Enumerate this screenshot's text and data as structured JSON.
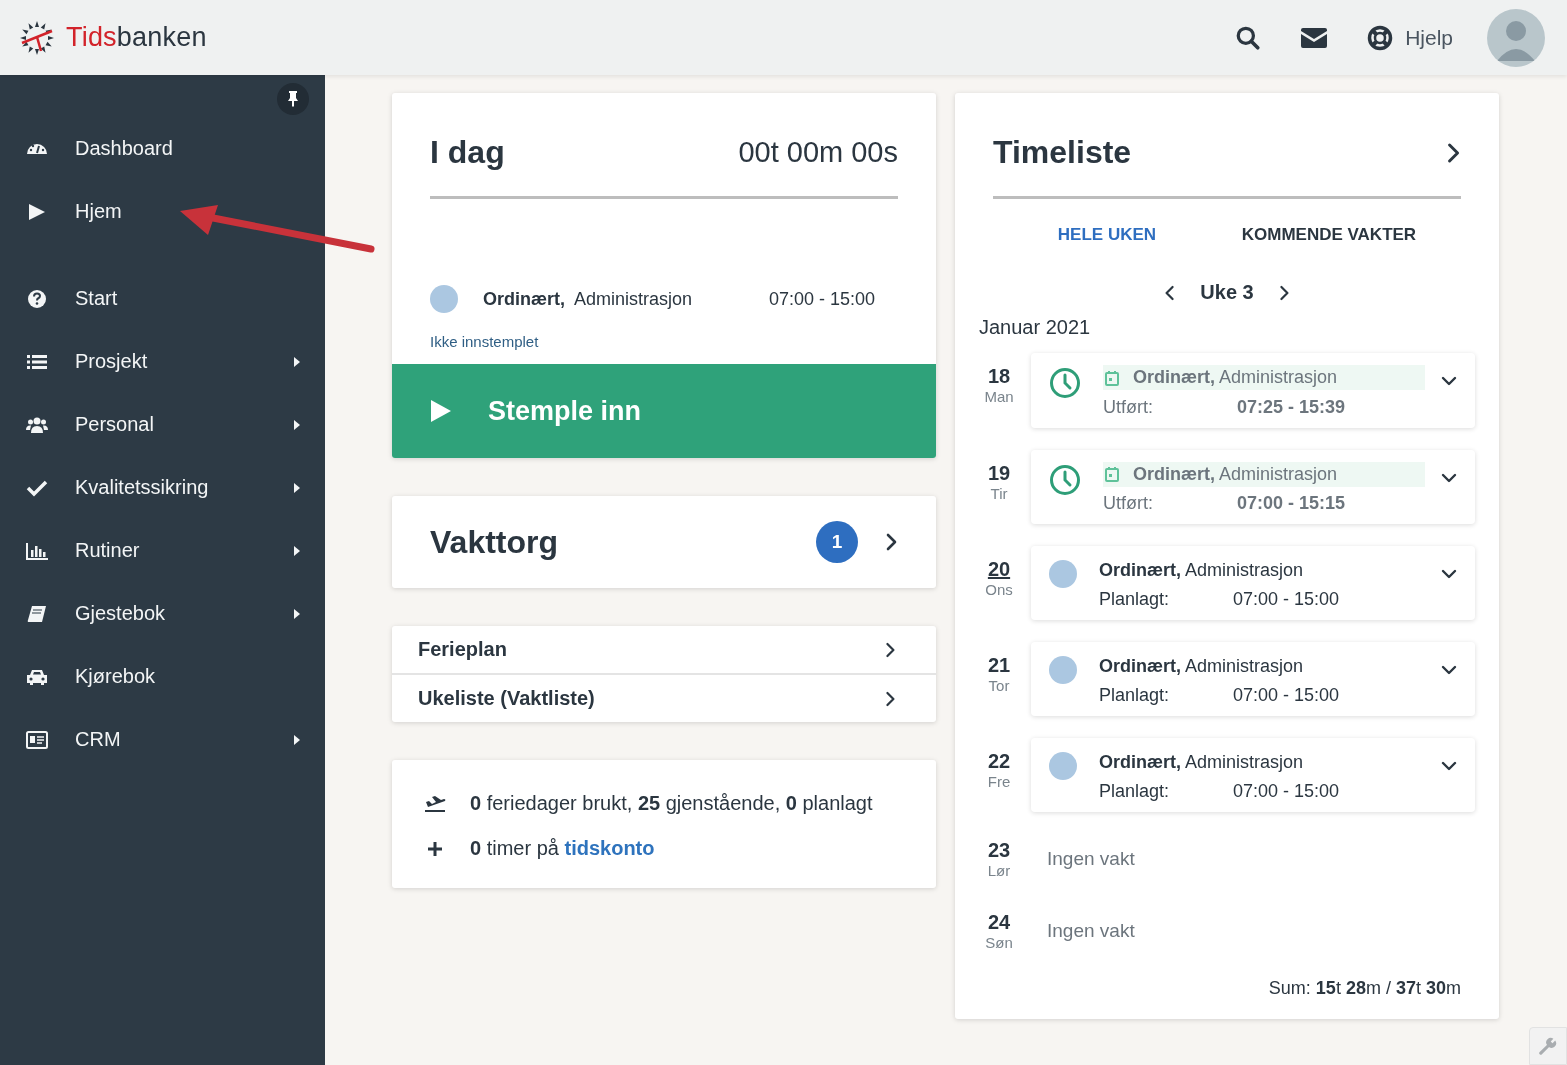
{
  "header": {
    "logo": {
      "accent": "Tids",
      "rest": "banken"
    },
    "help": "Hjelp"
  },
  "sidebar": {
    "items": [
      {
        "label": "Dashboard",
        "submenu": false
      },
      {
        "label": "Hjem",
        "submenu": false
      },
      {
        "label": "Start",
        "submenu": false
      },
      {
        "label": "Prosjekt",
        "submenu": true
      },
      {
        "label": "Personal",
        "submenu": true
      },
      {
        "label": "Kvalitetssikring",
        "submenu": true
      },
      {
        "label": "Rutiner",
        "submenu": true
      },
      {
        "label": "Gjestebok",
        "submenu": true
      },
      {
        "label": "Kjørebok",
        "submenu": false
      },
      {
        "label": "CRM",
        "submenu": true
      }
    ]
  },
  "today": {
    "title": "I dag",
    "timer": "00t 00m 00s",
    "shift": {
      "title": "**Ordinært,**  Administrasjon",
      "time": "07:00 - 15:00"
    },
    "status": "Ikke innstemplet",
    "button": "Stemple inn"
  },
  "vakttorg": {
    "title": "Vakttorg",
    "badge": "1"
  },
  "links": [
    "Ferieplan",
    "Ukeliste (Vaktliste)"
  ],
  "info": {
    "vacation": "**0** feriedager brukt, **25** gjenstående, **0** planlagt",
    "account": "**0** timer på",
    "account_link": "tidskonto"
  },
  "timeliste": {
    "title": "Timeliste",
    "tabs": [
      {
        "label": "HELE UKEN",
        "selected": true
      },
      {
        "label": "KOMMENDE VAKTER",
        "selected": false
      }
    ],
    "week": "Uke 3",
    "month": "Januar 2021",
    "days": [
      {
        "day": "18",
        "weekday": "Man",
        "today": false,
        "kind": "done",
        "title": "**Ordinært,** Administrasjon",
        "label": "Utført:",
        "time": "07:25 - 15:39"
      },
      {
        "day": "19",
        "weekday": "Tir",
        "today": false,
        "kind": "done",
        "title": "**Ordinært,** Administrasjon",
        "label": "Utført:",
        "time": "07:00 - 15:15"
      },
      {
        "day": "20",
        "weekday": "Ons",
        "today": true,
        "kind": "planned",
        "title": "**Ordinært,** Administrasjon",
        "label": "Planlagt:",
        "time": "07:00 - 15:00"
      },
      {
        "day": "21",
        "weekday": "Tor",
        "today": false,
        "kind": "planned",
        "title": "**Ordinært,** Administrasjon",
        "label": "Planlagt:",
        "time": "07:00 - 15:00"
      },
      {
        "day": "22",
        "weekday": "Fre",
        "today": false,
        "kind": "planned",
        "title": "**Ordinært,** Administrasjon",
        "label": "Planlagt:",
        "time": "07:00 - 15:00"
      },
      {
        "day": "23",
        "weekday": "Lør",
        "today": false,
        "kind": "none",
        "text": "Ingen vakt"
      },
      {
        "day": "24",
        "weekday": "Søn",
        "today": false,
        "kind": "none",
        "text": "Ingen vakt"
      }
    ],
    "sum": "Sum: **15**t **28**m / **37**t **30**m"
  }
}
